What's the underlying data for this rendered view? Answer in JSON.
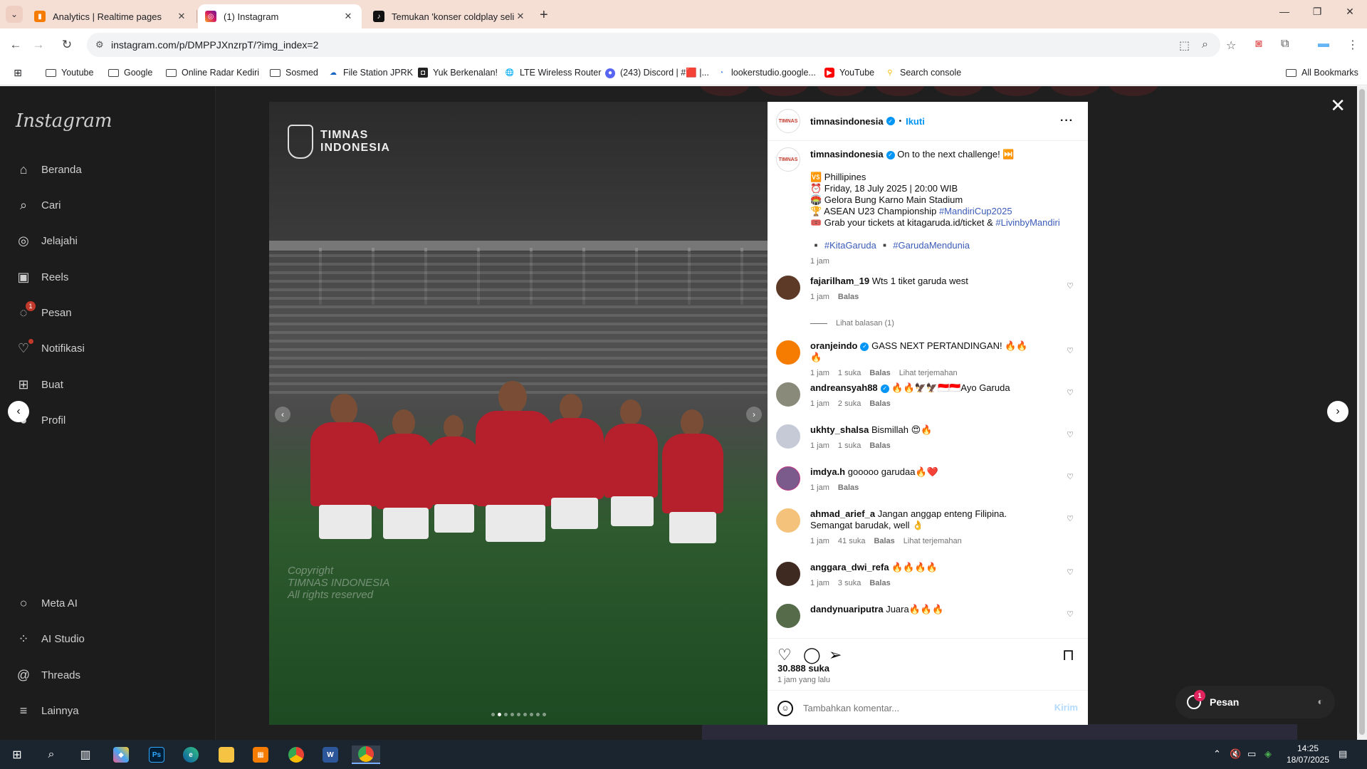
{
  "browser": {
    "tabs": [
      {
        "title": "Analytics | Realtime pages",
        "active": false
      },
      {
        "title": "(1) Instagram",
        "active": true
      },
      {
        "title": "Temukan 'konser coldplay selin",
        "active": false
      }
    ],
    "url": "instagram.com/p/DMPPJXnzrpT/?img_index=2",
    "bookmarks": [
      {
        "label": "Youtube"
      },
      {
        "label": "Google"
      },
      {
        "label": "Online Radar Kediri"
      },
      {
        "label": "Sosmed"
      },
      {
        "label": "File Station JPRK"
      },
      {
        "label": "Yuk Berkenalan!"
      },
      {
        "label": "LTE Wireless Router"
      },
      {
        "label": "(243) Discord | #🟥 |..."
      },
      {
        "label": "lookerstudio.google..."
      },
      {
        "label": "YouTube"
      },
      {
        "label": "Search console"
      }
    ],
    "all_bookmarks": "All Bookmarks"
  },
  "instagram": {
    "logo": "Instagram",
    "nav": [
      {
        "label": "Beranda",
        "icon": "home-icon"
      },
      {
        "label": "Cari",
        "icon": "search-icon"
      },
      {
        "label": "Jelajahi",
        "icon": "compass-icon"
      },
      {
        "label": "Reels",
        "icon": "reels-icon"
      },
      {
        "label": "Pesan",
        "icon": "messenger-icon",
        "badge": "1"
      },
      {
        "label": "Notifikasi",
        "icon": "heart-icon"
      },
      {
        "label": "Buat",
        "icon": "plus-square-icon"
      },
      {
        "label": "Profil",
        "icon": "profile-icon"
      }
    ],
    "nav_bottom": [
      {
        "label": "Meta AI",
        "icon": "meta-ai-icon"
      },
      {
        "label": "AI Studio",
        "icon": "ai-studio-icon"
      },
      {
        "label": "Threads",
        "icon": "threads-icon"
      },
      {
        "label": "Lainnya",
        "icon": "menu-icon"
      }
    ]
  },
  "post": {
    "image": {
      "wordmark_line1": "TIMNAS",
      "wordmark_line2": "INDONESIA",
      "watermark_line1": "Copyright",
      "watermark_line2": "TIMNAS INDONESIA",
      "watermark_line3": "All rights reserved",
      "slide_count": 9,
      "current_slide": 2
    },
    "author": "timnasindonesia",
    "avatar_text": "TIMNAS",
    "follow_label": "Ikuti",
    "caption": {
      "line1": "On to the next challenge! ⏭️",
      "line2": "🆚 Phillipines",
      "line3": "⏰ Friday, 18 July 2025 | 20:00 WIB",
      "line4": "🏟️ Gelora Bung Karno Main Stadium",
      "line5_text": "🏆 ASEAN U23 Championship ",
      "line5_tag": "#MandiriCup2025",
      "line6_text": "🎟️ Grab your tickets at kitagaruda.id/ticket & ",
      "line6_tag": "#LivinbyMandiri",
      "tag1": "#KitaGaruda",
      "tag2": "#GarudaMendunia",
      "bullet": "▪️",
      "time": "1 jam"
    },
    "comments": [
      {
        "user": "fajarilham_19",
        "text": "Wts 1 tiket garuda west",
        "time": "1 jam",
        "likes": "",
        "reply": "Balas",
        "translate": ""
      },
      {
        "user": "oranjeindo",
        "text": "GASS NEXT PERTANDINGAN! 🔥🔥🔥",
        "time": "1 jam",
        "likes": "1 suka",
        "reply": "Balas",
        "translate": "Lihat terjemahan"
      },
      {
        "user": "andreansyah88",
        "text": "🔥🔥🦅🦅🇮🇩🇮🇩Ayo Garuda",
        "time": "1 jam",
        "likes": "2 suka",
        "reply": "Balas",
        "translate": ""
      },
      {
        "user": "ukhty_shalsa",
        "text": "Bismillah 😍🔥",
        "time": "1 jam",
        "likes": "1 suka",
        "reply": "Balas",
        "translate": ""
      },
      {
        "user": "imdya.h",
        "text": "gooooo garudaa🔥❤️",
        "time": "1 jam",
        "likes": "",
        "reply": "Balas",
        "translate": ""
      },
      {
        "user": "ahmad_arief_a",
        "text": "Jangan anggap enteng Filipina. Semangat barudak, well 👌",
        "time": "1 jam",
        "likes": "41 suka",
        "reply": "Balas",
        "translate": "Lihat terjemahan"
      },
      {
        "user": "anggara_dwi_refa",
        "text": "🔥🔥🔥🔥",
        "time": "1 jam",
        "likes": "3 suka",
        "reply": "Balas",
        "translate": ""
      },
      {
        "user": "dandynuariputra",
        "text": "Juara🔥🔥🔥",
        "time": "",
        "likes": "",
        "reply": "",
        "translate": ""
      }
    ],
    "view_replies": "Lihat balasan (1)",
    "likes": "30.888 suka",
    "time_ago": "1 jam yang lalu",
    "add_comment_placeholder": "Tambahkan komentar...",
    "post_button": "Kirim"
  },
  "messages_pill": {
    "label": "Pesan",
    "badge": "1"
  },
  "taskbar": {
    "time": "14:25",
    "date": "18/07/2025"
  }
}
